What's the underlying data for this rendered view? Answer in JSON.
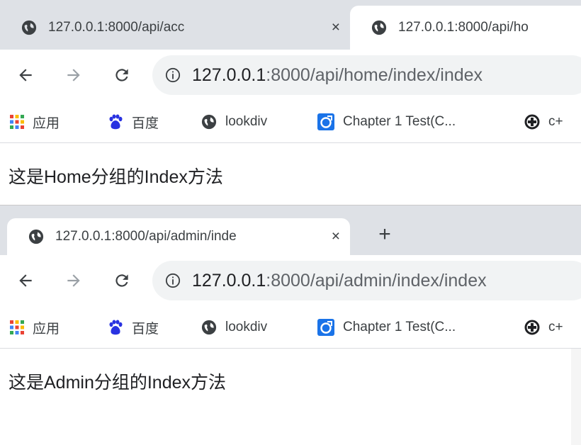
{
  "top_window": {
    "tabs": [
      {
        "title": "127.0.0.1:8000/api/acc",
        "close": "×",
        "active": false
      },
      {
        "title": "127.0.0.1:8000/api/ho",
        "active": true
      }
    ],
    "url": {
      "host": "127.0.0.1",
      "rest": ":8000/api/home/index/index"
    },
    "bookmarks": [
      {
        "label": "应用",
        "icon": "apps-grid-icon"
      },
      {
        "label": "百度",
        "icon": "baidu-paw-icon"
      },
      {
        "label": "lookdiv",
        "icon": "globe-icon"
      },
      {
        "label": "Chapter 1 Test(C...",
        "icon": "chapter-test-icon"
      },
      {
        "label": "c+",
        "icon": "cplus-icon"
      }
    ],
    "page_text": "这是Home分组的Index方法"
  },
  "bottom_window": {
    "tabs": [
      {
        "title": "127.0.0.1:8000/api/admin/inde",
        "close": "×",
        "active": true
      }
    ],
    "new_tab": "+",
    "url": {
      "host": "127.0.0.1",
      "rest": ":8000/api/admin/index/index"
    },
    "bookmarks": [
      {
        "label": "应用",
        "icon": "apps-grid-icon"
      },
      {
        "label": "百度",
        "icon": "baidu-paw-icon"
      },
      {
        "label": "lookdiv",
        "icon": "globe-icon"
      },
      {
        "label": "Chapter 1 Test(C...",
        "icon": "chapter-test-icon"
      },
      {
        "label": "c+",
        "icon": "cplus-icon"
      }
    ],
    "page_text": "这是Admin分组的Index方法"
  },
  "colors": {
    "tabstrip": "#dee1e6",
    "omnibox": "#f1f3f4",
    "icon": "#3c4043",
    "disabled_icon": "#9aa0a6",
    "baidu_blue": "#2932e1",
    "chapter_blue": "#1a73e8"
  }
}
